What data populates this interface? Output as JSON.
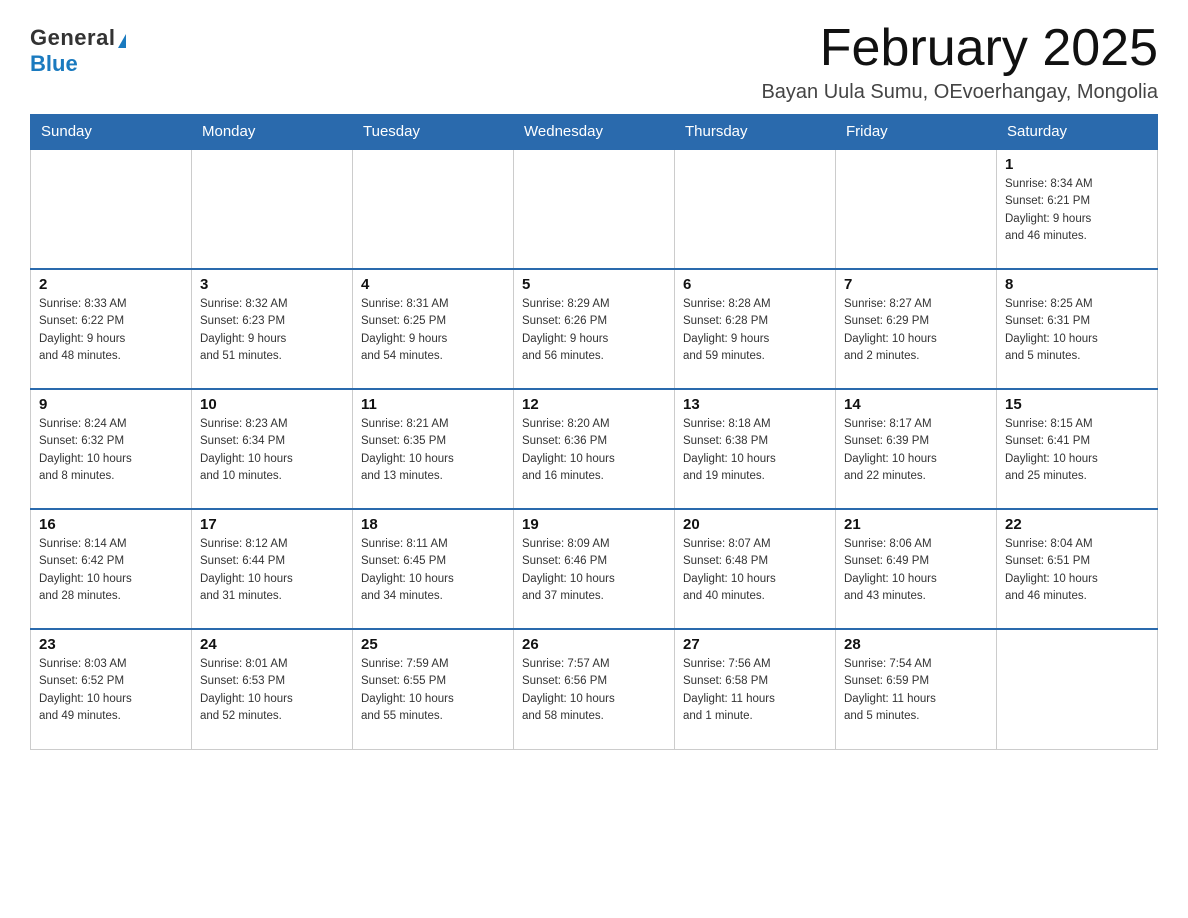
{
  "logo": {
    "general": "General",
    "blue": "Blue"
  },
  "title": "February 2025",
  "location": "Bayan Uula Sumu, OEvoerhangay, Mongolia",
  "days_of_week": [
    "Sunday",
    "Monday",
    "Tuesday",
    "Wednesday",
    "Thursday",
    "Friday",
    "Saturday"
  ],
  "weeks": [
    [
      {
        "day": "",
        "info": ""
      },
      {
        "day": "",
        "info": ""
      },
      {
        "day": "",
        "info": ""
      },
      {
        "day": "",
        "info": ""
      },
      {
        "day": "",
        "info": ""
      },
      {
        "day": "",
        "info": ""
      },
      {
        "day": "1",
        "info": "Sunrise: 8:34 AM\nSunset: 6:21 PM\nDaylight: 9 hours\nand 46 minutes."
      }
    ],
    [
      {
        "day": "2",
        "info": "Sunrise: 8:33 AM\nSunset: 6:22 PM\nDaylight: 9 hours\nand 48 minutes."
      },
      {
        "day": "3",
        "info": "Sunrise: 8:32 AM\nSunset: 6:23 PM\nDaylight: 9 hours\nand 51 minutes."
      },
      {
        "day": "4",
        "info": "Sunrise: 8:31 AM\nSunset: 6:25 PM\nDaylight: 9 hours\nand 54 minutes."
      },
      {
        "day": "5",
        "info": "Sunrise: 8:29 AM\nSunset: 6:26 PM\nDaylight: 9 hours\nand 56 minutes."
      },
      {
        "day": "6",
        "info": "Sunrise: 8:28 AM\nSunset: 6:28 PM\nDaylight: 9 hours\nand 59 minutes."
      },
      {
        "day": "7",
        "info": "Sunrise: 8:27 AM\nSunset: 6:29 PM\nDaylight: 10 hours\nand 2 minutes."
      },
      {
        "day": "8",
        "info": "Sunrise: 8:25 AM\nSunset: 6:31 PM\nDaylight: 10 hours\nand 5 minutes."
      }
    ],
    [
      {
        "day": "9",
        "info": "Sunrise: 8:24 AM\nSunset: 6:32 PM\nDaylight: 10 hours\nand 8 minutes."
      },
      {
        "day": "10",
        "info": "Sunrise: 8:23 AM\nSunset: 6:34 PM\nDaylight: 10 hours\nand 10 minutes."
      },
      {
        "day": "11",
        "info": "Sunrise: 8:21 AM\nSunset: 6:35 PM\nDaylight: 10 hours\nand 13 minutes."
      },
      {
        "day": "12",
        "info": "Sunrise: 8:20 AM\nSunset: 6:36 PM\nDaylight: 10 hours\nand 16 minutes."
      },
      {
        "day": "13",
        "info": "Sunrise: 8:18 AM\nSunset: 6:38 PM\nDaylight: 10 hours\nand 19 minutes."
      },
      {
        "day": "14",
        "info": "Sunrise: 8:17 AM\nSunset: 6:39 PM\nDaylight: 10 hours\nand 22 minutes."
      },
      {
        "day": "15",
        "info": "Sunrise: 8:15 AM\nSunset: 6:41 PM\nDaylight: 10 hours\nand 25 minutes."
      }
    ],
    [
      {
        "day": "16",
        "info": "Sunrise: 8:14 AM\nSunset: 6:42 PM\nDaylight: 10 hours\nand 28 minutes."
      },
      {
        "day": "17",
        "info": "Sunrise: 8:12 AM\nSunset: 6:44 PM\nDaylight: 10 hours\nand 31 minutes."
      },
      {
        "day": "18",
        "info": "Sunrise: 8:11 AM\nSunset: 6:45 PM\nDaylight: 10 hours\nand 34 minutes."
      },
      {
        "day": "19",
        "info": "Sunrise: 8:09 AM\nSunset: 6:46 PM\nDaylight: 10 hours\nand 37 minutes."
      },
      {
        "day": "20",
        "info": "Sunrise: 8:07 AM\nSunset: 6:48 PM\nDaylight: 10 hours\nand 40 minutes."
      },
      {
        "day": "21",
        "info": "Sunrise: 8:06 AM\nSunset: 6:49 PM\nDaylight: 10 hours\nand 43 minutes."
      },
      {
        "day": "22",
        "info": "Sunrise: 8:04 AM\nSunset: 6:51 PM\nDaylight: 10 hours\nand 46 minutes."
      }
    ],
    [
      {
        "day": "23",
        "info": "Sunrise: 8:03 AM\nSunset: 6:52 PM\nDaylight: 10 hours\nand 49 minutes."
      },
      {
        "day": "24",
        "info": "Sunrise: 8:01 AM\nSunset: 6:53 PM\nDaylight: 10 hours\nand 52 minutes."
      },
      {
        "day": "25",
        "info": "Sunrise: 7:59 AM\nSunset: 6:55 PM\nDaylight: 10 hours\nand 55 minutes."
      },
      {
        "day": "26",
        "info": "Sunrise: 7:57 AM\nSunset: 6:56 PM\nDaylight: 10 hours\nand 58 minutes."
      },
      {
        "day": "27",
        "info": "Sunrise: 7:56 AM\nSunset: 6:58 PM\nDaylight: 11 hours\nand 1 minute."
      },
      {
        "day": "28",
        "info": "Sunrise: 7:54 AM\nSunset: 6:59 PM\nDaylight: 11 hours\nand 5 minutes."
      },
      {
        "day": "",
        "info": ""
      }
    ]
  ]
}
